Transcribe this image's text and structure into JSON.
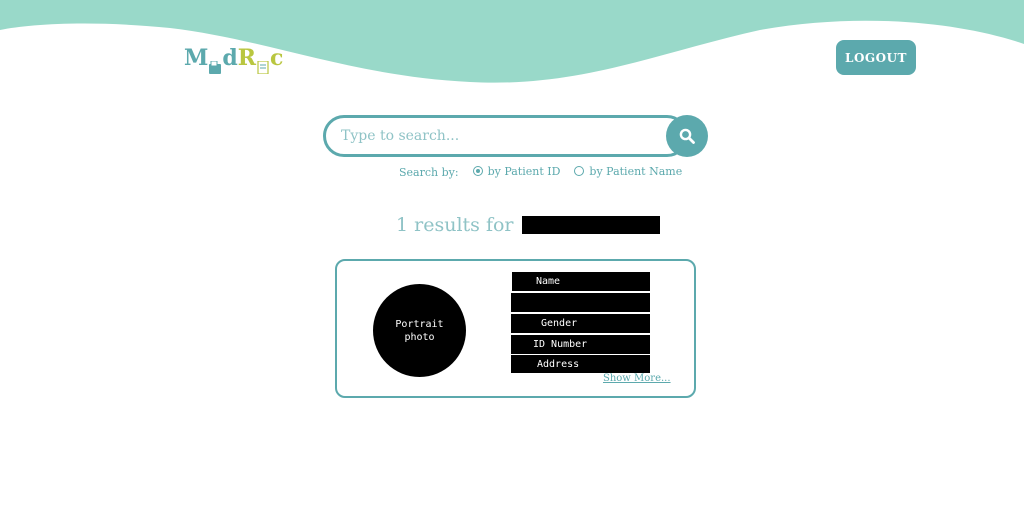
{
  "header": {
    "logo": {
      "part1": "M",
      "part2": "d",
      "part3": "R",
      "part4": "c"
    },
    "logout_label": "LOGOUT"
  },
  "search": {
    "placeholder": "Type to search...",
    "value": "",
    "search_by_label": "Search by:",
    "options": [
      {
        "label": "by Patient ID",
        "checked": true
      },
      {
        "label": "by Patient Name",
        "checked": false
      }
    ]
  },
  "results": {
    "summary_prefix": "1 results for"
  },
  "result_card": {
    "portrait_line1": "Portrait",
    "portrait_line2": "photo",
    "fields": {
      "name": "Name",
      "gender": "Gender",
      "id_number": "ID Number",
      "address": "Address"
    },
    "show_more": "Show More..."
  },
  "colors": {
    "accent": "#5ca9ad",
    "wave": "#99d9c9",
    "logo_green": "#b9c640",
    "muted_accent": "#8fc3c6"
  }
}
